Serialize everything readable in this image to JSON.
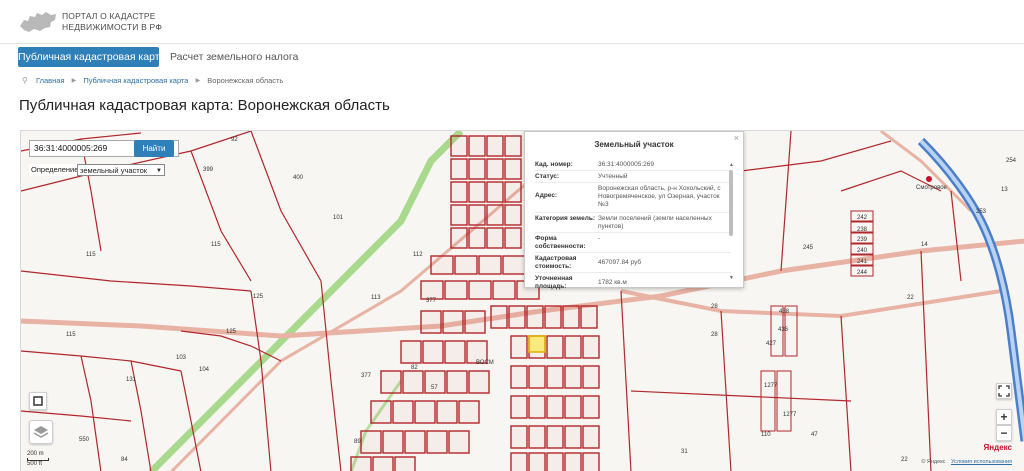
{
  "header": {
    "portal_title_line1": "ПОРТАЛ О КАДАСТРЕ",
    "portal_title_line2": "НЕДВИЖИМОСТИ В РФ"
  },
  "tabs": [
    {
      "label": "Публичная кадастровая карта",
      "active": true
    },
    {
      "label": "Расчет земельного налога",
      "active": false
    }
  ],
  "breadcrumb": {
    "items": [
      "Главная",
      "Публичная кадастровая карта",
      "Воронежская область"
    ]
  },
  "page_title": "Публичная кадастровая карта: Воронежская область",
  "search": {
    "value": "36:31:4000005:269",
    "button_label": "Найти"
  },
  "definition": {
    "label": "Определение",
    "selected": "земельный участок"
  },
  "popup": {
    "title": "Земельный участок",
    "close_icon": "×",
    "rows": [
      {
        "key": "Кад. номер:",
        "value": "36:31:4000005:269"
      },
      {
        "key": "Статус:",
        "value": "Учтенный"
      },
      {
        "key": "Адрес:",
        "value": "Воронежская область, р-н Хохольский, с Новогремяченское, ул Озерная, участок №3"
      },
      {
        "key": "Категория земель:",
        "value": "Земли поселений (земли населенных пунктов)"
      },
      {
        "key": "Форма собственности:",
        "value": "-"
      },
      {
        "key": "Кадастровая стоимость:",
        "value": "467097.84 руб"
      },
      {
        "key": "Уточненная площадь:",
        "value": "1782 кв.м"
      }
    ]
  },
  "map": {
    "parcel_labels": [
      "92",
      "399",
      "400",
      "101",
      "115",
      "115",
      "125",
      "125",
      "103",
      "104",
      "115",
      "112",
      "113",
      "377",
      "377",
      "82",
      "57",
      "89",
      "550",
      "84",
      "131",
      "28",
      "28",
      "438",
      "436",
      "427",
      "1277",
      "1277",
      "110",
      "47",
      "31",
      "245",
      "238",
      "242",
      "239",
      "240",
      "241",
      "244",
      "14",
      "253",
      "254",
      "22",
      "22",
      "13"
    ],
    "village_label": "Смотровое",
    "street_label": "ВОСМ",
    "scale_text_1": "200 m",
    "scale_text_2": "500 ft",
    "yandex": "Яндекс",
    "copyright_text": "© Яндекс",
    "terms_text": "Условия использования"
  },
  "colors": {
    "tab_active": "#2f7fb9",
    "parcel_border": "#b3262b",
    "road": "#e8b3a5",
    "river": "#4d7ec9",
    "rail": "#8fcf6a"
  }
}
